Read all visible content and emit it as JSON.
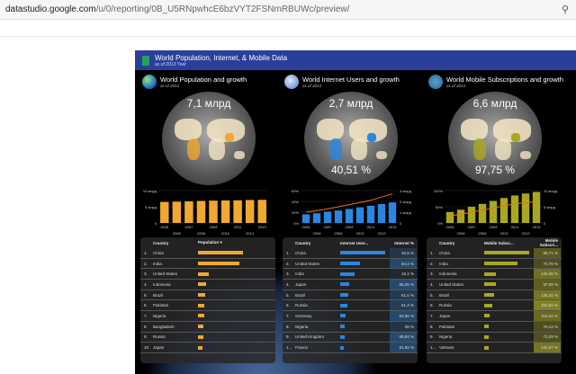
{
  "browser": {
    "url_host": "datastudio.google.com",
    "url_path": "/u/0/reporting/0B_U5RNpwhcE6bzVYT2FSNmRBUWc/preview/"
  },
  "report": {
    "title": "World Population, Internet, & Mobile Data",
    "subtitle": "as of 2013 Year"
  },
  "colors": {
    "population": "#f0a830",
    "internet": "#2a86e0",
    "mobile": "#a8a820",
    "line": "#f07020"
  },
  "panels": [
    {
      "title": "World Population and growth",
      "subtitle": "as of 2013",
      "big": "7,1 млрд",
      "pct": "",
      "color": "#f0a830",
      "chart_data": {
        "type": "bar",
        "categories": [
          "2005",
          "2006",
          "2007",
          "2008",
          "2009",
          "2010",
          "2011",
          "2012",
          "2013"
        ],
        "values": [
          6.5,
          6.6,
          6.7,
          6.8,
          6.9,
          6.95,
          7.0,
          7.1,
          7.15
        ],
        "ylim": [
          0,
          10
        ],
        "yticks": [
          "0",
          "5 млрд",
          "10 млрд"
        ]
      }
    },
    {
      "title": "World Internet Users and growth",
      "subtitle": "as of 2013",
      "big": "2,7 млрд",
      "pct": "40,51 %",
      "color": "#2a86e0",
      "chart_data": {
        "type": "bar",
        "categories": [
          "2005",
          "2006",
          "2007",
          "2008",
          "2009",
          "2010",
          "2011",
          "2012",
          "2013"
        ],
        "values": [
          16,
          18,
          21,
          23,
          26,
          29,
          32,
          35,
          38
        ],
        "ylim": [
          0,
          60
        ],
        "yticks": [
          "0%",
          "20%",
          "40%",
          "60%"
        ],
        "line": [
          1.0,
          1.15,
          1.3,
          1.5,
          1.7,
          1.9,
          2.1,
          2.4,
          2.7
        ],
        "y2lim": [
          0,
          3
        ],
        "y2ticks": [
          "0",
          "1 млрд",
          "2 млрд",
          "3 млрд"
        ]
      }
    },
    {
      "title": "World Mobile Subscriptions and growth",
      "subtitle": "as of 2013",
      "big": "6,6 млрд",
      "pct": "97,75 %",
      "color": "#a8a820",
      "chart_data": {
        "type": "bar",
        "categories": [
          "2005",
          "2006",
          "2007",
          "2008",
          "2009",
          "2010",
          "2011",
          "2012",
          "2013"
        ],
        "values": [
          34,
          41,
          50,
          59,
          68,
          77,
          85,
          91,
          96
        ],
        "ylim": [
          0,
          100
        ],
        "yticks": [
          "0%",
          "50%",
          "100%"
        ],
        "line": [
          2.2,
          2.7,
          3.3,
          4.0,
          4.6,
          5.3,
          5.9,
          6.3,
          6.6
        ],
        "y2lim": [
          0,
          10
        ],
        "y2ticks": [
          "0",
          "5 млрд",
          "10 млрд"
        ]
      }
    }
  ],
  "tables": [
    {
      "headers": [
        "Country",
        "Population ▾",
        ""
      ],
      "rows": [
        [
          "1.",
          "China",
          100,
          ""
        ],
        [
          "2.",
          "India",
          91,
          ""
        ],
        [
          "3.",
          "United States",
          24,
          ""
        ],
        [
          "4.",
          "Indonesia",
          18,
          ""
        ],
        [
          "5.",
          "Brazil",
          15,
          ""
        ],
        [
          "6.",
          "Pakistan",
          14,
          ""
        ],
        [
          "7.",
          "Nigeria",
          13,
          ""
        ],
        [
          "8.",
          "Bangladesh",
          11,
          ""
        ],
        [
          "9.",
          "Russia",
          11,
          ""
        ],
        [
          "10.",
          "Japan",
          10,
          ""
        ]
      ]
    },
    {
      "headers": [
        "Country",
        "Internet User...",
        "Internet %"
      ],
      "rows": [
        [
          "1.",
          "China",
          100,
          "45,8 %"
        ],
        [
          "2.",
          "United States",
          44,
          "84,2 %"
        ],
        [
          "3.",
          "India",
          32,
          "15,1 %"
        ],
        [
          "4.",
          "Japan",
          20,
          "86,25 %"
        ],
        [
          "5.",
          "Brazil",
          17,
          "51,6 %"
        ],
        [
          "6.",
          "Russia",
          15,
          "61,4 %"
        ],
        [
          "7.",
          "Germany",
          11,
          "83,96 %"
        ],
        [
          "8.",
          "Nigeria",
          9,
          "38 %"
        ],
        [
          "9.",
          "United Kingdom",
          9,
          "89,84 %"
        ],
        [
          "1...",
          "France",
          8,
          "81,92 %"
        ]
      ]
    },
    {
      "headers": [
        "Country",
        "Mobile Subsc...",
        "Mobile Subscri..."
      ],
      "rows": [
        [
          "1.",
          "China",
          100,
          "88,71 %"
        ],
        [
          "2.",
          "India",
          73,
          "70,78 %"
        ],
        [
          "3.",
          "Indonesia",
          26,
          "125,36 %"
        ],
        [
          "4.",
          "United States",
          26,
          "97,08 %"
        ],
        [
          "5.",
          "Brazil",
          22,
          "135,31 %"
        ],
        [
          "6.",
          "Russia",
          17,
          "152,84 %"
        ],
        [
          "7.",
          "Japan",
          11,
          "116,32 %"
        ],
        [
          "8.",
          "Pakistan",
          10,
          "70,13 %"
        ],
        [
          "9.",
          "Nigeria",
          10,
          "73,29 %"
        ],
        [
          "1...",
          "Vietnam",
          10,
          "134,97 %"
        ]
      ]
    }
  ]
}
